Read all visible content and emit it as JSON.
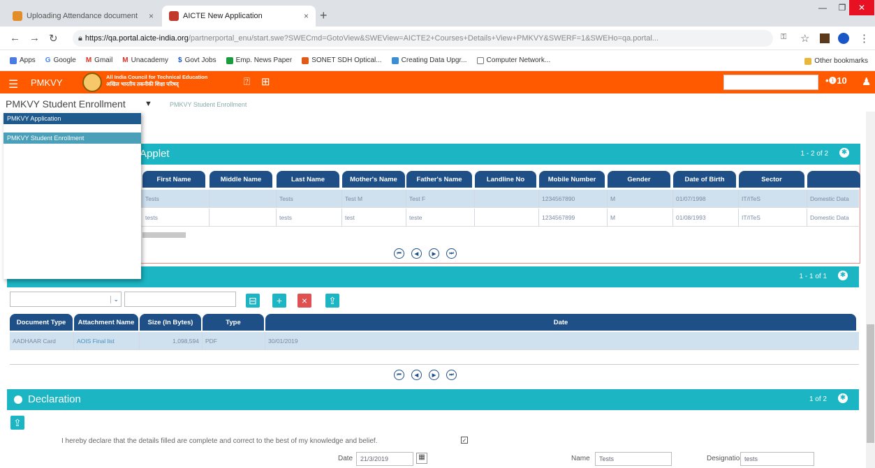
{
  "browser": {
    "tabs": [
      {
        "title": "Uploading Attendance document"
      },
      {
        "title": "AICTE New Application"
      }
    ],
    "url_domain": "https://qa.portal.aicte-india.org",
    "url_rest": "/partnerportal_enu/start.swe?SWECmd=GotoView&SWEView=AICTE2+Courses+Details+View+PMKVY&SWERF=1&SWEHo=qa.portal...",
    "bookmarks": [
      "Apps",
      "Google",
      "Gmail",
      "Unacademy",
      "Govt Jobs",
      "Emp. News Paper",
      "SONET SDH Optical...",
      "Creating Data Upgr...",
      "Computer Network..."
    ],
    "other_bookmarks": "Other bookmarks"
  },
  "app": {
    "name": "PMKVY",
    "org_line1": "All India Council for Technical Education",
    "org_line2": "अखिल भारतीय तकनीकी शिक्षा परिषद्",
    "notif_count": "10",
    "screen_name": "PMKVY Student Enrollment",
    "breadcrumb": "PMKVY Student Enrollment",
    "dropdown_items": [
      "PMKVY Application",
      "PMKVY Student Enrollment"
    ]
  },
  "applet1": {
    "title": "Applet",
    "count": "1 - 2 of 2",
    "columns": [
      "First Name",
      "Middle Name",
      "Last Name",
      "Mother's Name",
      "Father's Name",
      "Landline No",
      "Mobile Number",
      "Gender",
      "Date of Birth",
      "Sector",
      ""
    ],
    "rows": [
      [
        "Tests",
        "",
        "Tests",
        "Test M",
        "Test F",
        "",
        "1234567890",
        "M",
        "01/07/1998",
        "IT/ITeS",
        "Domestic Data"
      ],
      [
        "tests",
        "",
        "tests",
        "test",
        "teste",
        "",
        "1234567899",
        "M",
        "01/08/1993",
        "IT/ITeS",
        "Domestic Data"
      ]
    ]
  },
  "applet2": {
    "count": "1 - 1 of 1",
    "columns": [
      "Document Type",
      "Attachment Name",
      "Size (In Bytes)",
      "Type",
      "Date"
    ],
    "rows": [
      [
        "AADHAAR Card",
        "AOIS Final list",
        "1,098,594",
        "PDF",
        "30/01/2019"
      ]
    ]
  },
  "declaration": {
    "title": "Declaration",
    "count": "1 of 2",
    "statement": "I hereby declare that the details filled are complete and correct to the best of my knowledge and belief.",
    "date_label": "Date",
    "date_value": "21/3/2019",
    "name_label": "Name",
    "name_value": "Tests",
    "designation_label": "Designation",
    "designation_value": "tests"
  },
  "colors": {
    "header": "#ff5a00",
    "applet_header": "#1bb5c3",
    "column_header": "#1e4f86"
  }
}
